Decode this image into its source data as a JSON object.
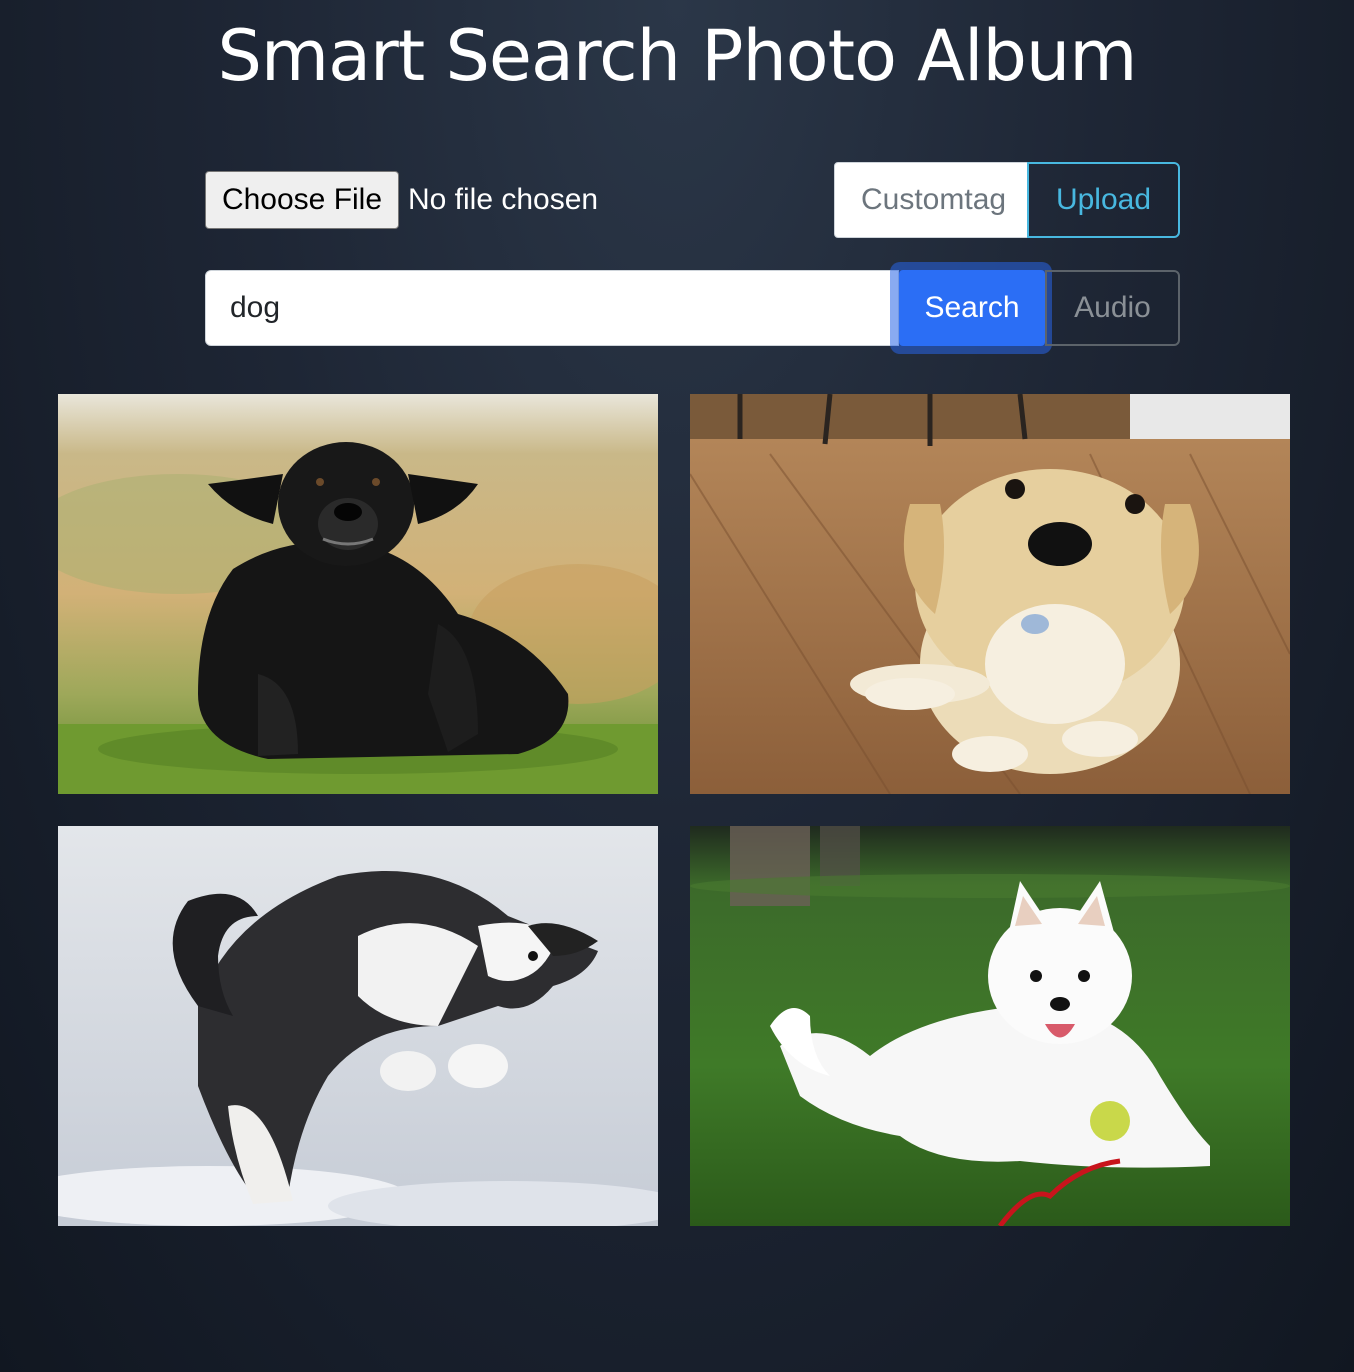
{
  "page": {
    "title": "Smart Search Photo Album"
  },
  "upload": {
    "choose_file_label": "Choose File",
    "file_status": "No file chosen",
    "custom_tag_placeholder": "Customtag",
    "upload_label": "Upload"
  },
  "search": {
    "query_value": "dog",
    "search_label": "Search",
    "audio_label": "Audio"
  },
  "results": [
    {
      "subject": "black labrador sitting in grass"
    },
    {
      "subject": "golden retriever puppy on wooden floor"
    },
    {
      "subject": "husky puppy jumping in snow"
    },
    {
      "subject": "white samoyed lying on grass with ball"
    }
  ],
  "colors": {
    "primary": "#2b6ef5",
    "info": "#48b8e0",
    "secondary": "#5c636a"
  }
}
